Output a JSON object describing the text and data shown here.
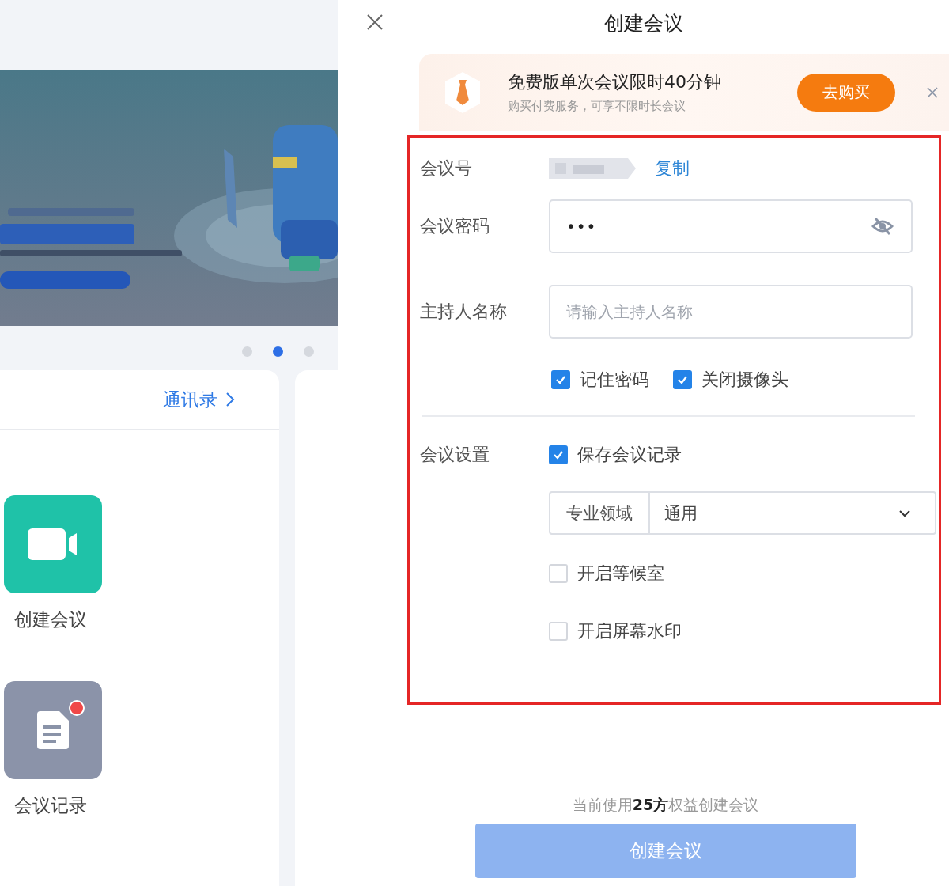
{
  "background": {
    "carousel_dots": [
      {
        "selected": false
      },
      {
        "selected": true
      },
      {
        "selected": false
      }
    ],
    "contacts_link": "通讯录",
    "actions": [
      {
        "label": "创建会议",
        "kind": "video",
        "badge": false
      },
      {
        "label": "会议记录",
        "kind": "document",
        "badge": true
      }
    ]
  },
  "dialog": {
    "title": "创建会议",
    "promo": {
      "title": "免费版单次会议限时40分钟",
      "subtitle": "购买付费服务，可享不限时长会议",
      "button": "去购买"
    },
    "form": {
      "meeting_number_label": "会议号",
      "copy_link": "复制",
      "password_label": "会议密码",
      "password_value": "•••",
      "host_label": "主持人名称",
      "host_placeholder": "请输入主持人名称",
      "options": [
        {
          "label": "记住密码",
          "checked": true
        },
        {
          "label": "关闭摄像头",
          "checked": true
        }
      ],
      "settings_label": "会议设置",
      "settings": [
        {
          "kind": "checkbox",
          "label": "保存会议记录",
          "checked": true
        },
        {
          "kind": "select",
          "label": "专业领域",
          "value": "通用"
        },
        {
          "kind": "checkbox",
          "label": "开启等候室",
          "checked": false
        },
        {
          "kind": "checkbox",
          "label": "开启屏幕水印",
          "checked": false
        }
      ]
    },
    "footer_note": "当前使用**25方**权益创建会议",
    "submit": {
      "label": "创建会议",
      "disabled": true
    }
  }
}
